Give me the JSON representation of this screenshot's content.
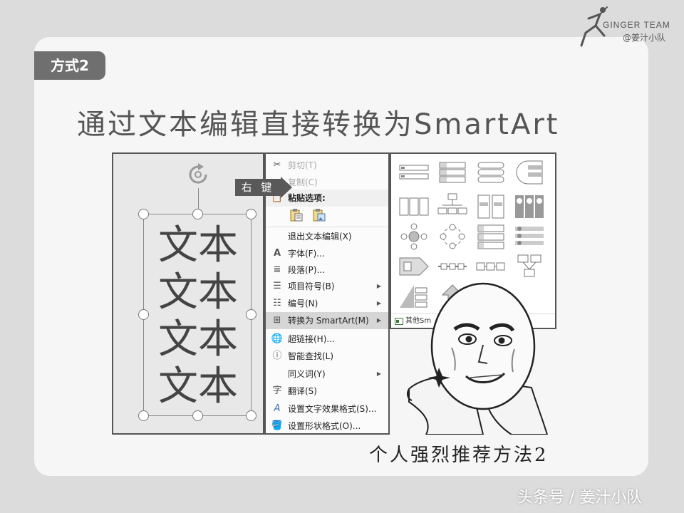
{
  "brand": {
    "title": "GINGER TEAM",
    "subtitle": "@姜汁小队"
  },
  "tag": "方式2",
  "headline": "通过文本编辑直接转换为SmartArt",
  "textbox": {
    "lines": [
      "文本",
      "文本",
      "文本",
      "文本"
    ]
  },
  "callout": "右 键",
  "menu": {
    "cut": "剪切(T)",
    "copy": "复制(C)",
    "paste_heading": "粘贴选项:",
    "exit_edit": "退出文本编辑(X)",
    "font": "字体(F)...",
    "paragraph": "段落(P)...",
    "bullets": "项目符号(B)",
    "numbering": "编号(N)",
    "convert": "转换为 SmartArt(M)",
    "hyperlink": "超链接(H)...",
    "smart_lookup": "智能查找(L)",
    "synonyms": "同义词(Y)",
    "translate": "翻译(S)",
    "text_effects": "设置文字效果格式(S)...",
    "shape_format": "设置形状格式(O)..."
  },
  "gallery": {
    "footer": "其他Sm"
  },
  "caption": "个人强烈推荐方法2",
  "watermark": "头条号 / 姜汁小队",
  "colors": {
    "tag_bg": "#6f6f6f",
    "callout_bg": "#595959",
    "menu_highlight": "#d6d6d6"
  }
}
